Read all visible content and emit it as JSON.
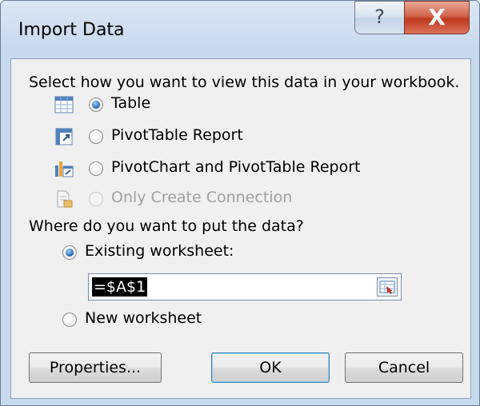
{
  "window": {
    "title": "Import Data"
  },
  "titlebar": {
    "help_glyph": "?",
    "close_glyph": "X"
  },
  "view": {
    "prompt": "Select how you want to view this data in your workbook.",
    "options": [
      {
        "label": "Table",
        "icon": "table-icon",
        "selected": true,
        "enabled": true
      },
      {
        "label": "PivotTable Report",
        "icon": "pivottable-icon",
        "selected": false,
        "enabled": true
      },
      {
        "label": "PivotChart and PivotTable Report",
        "icon": "pivotchart-icon",
        "selected": false,
        "enabled": true
      },
      {
        "label": "Only Create Connection",
        "icon": "connection-icon",
        "selected": false,
        "enabled": false
      }
    ]
  },
  "destination": {
    "prompt": "Where do you want to put the data?",
    "existing_label": "Existing worksheet:",
    "existing_selected": true,
    "reference_value": "=$A$1",
    "new_label": "New worksheet",
    "new_selected": false
  },
  "buttons": {
    "properties": "Properties...",
    "ok": "OK",
    "cancel": "Cancel"
  },
  "colors": {
    "accent": "#1c5fb0",
    "close": "#c0391f",
    "disabled_text": "#a0a0a0"
  }
}
